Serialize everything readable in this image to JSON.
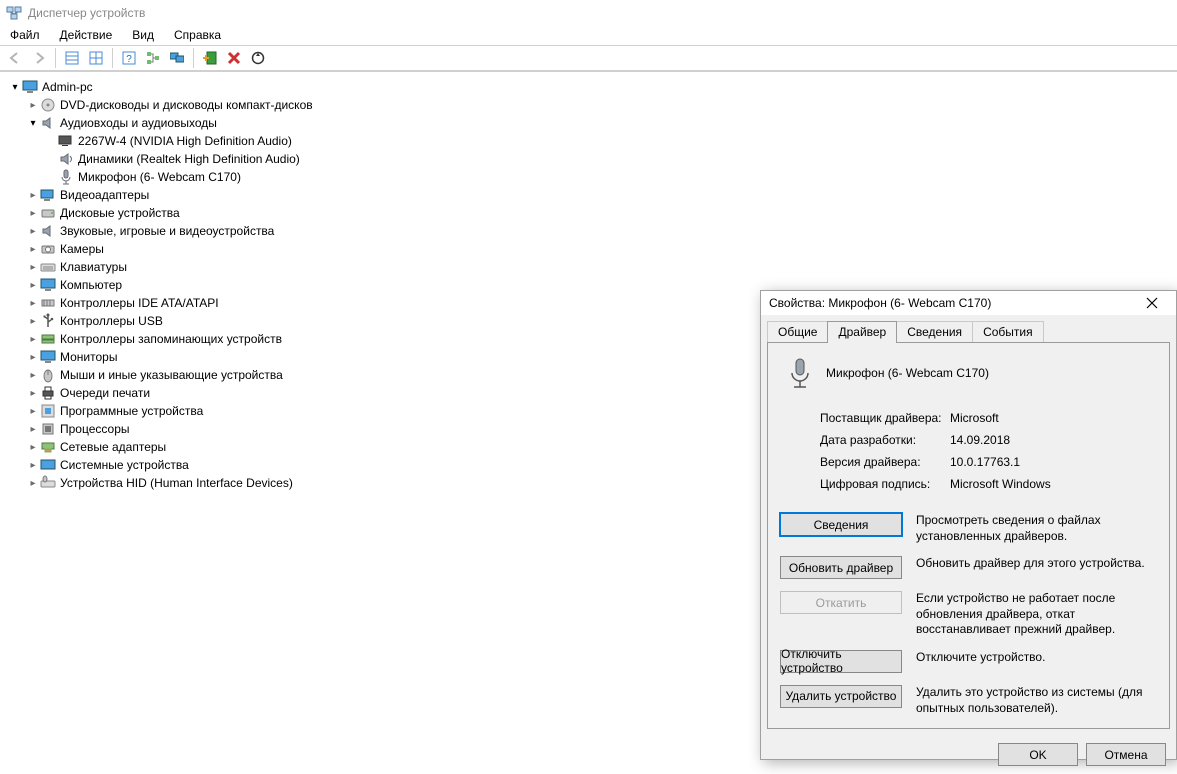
{
  "window": {
    "title": "Диспетчер устройств"
  },
  "menu": {
    "file": "Файл",
    "action": "Действие",
    "view": "Вид",
    "help": "Справка"
  },
  "toolbar_icons": {
    "back": "back-icon",
    "forward": "forward-icon",
    "table": "table-icon",
    "grid": "grid-icon",
    "help": "help-icon",
    "tree": "tree-icon",
    "monitors": "monitors-icon",
    "add_hw": "add-hardware-icon",
    "remove": "remove-icon",
    "refresh": "refresh-icon"
  },
  "tree": {
    "root": "Admin-pc",
    "dvd": "DVD-дисководы и дисководы компакт-дисков",
    "audio": "Аудиовходы и аудиовыходы",
    "audio_children": [
      "2267W-4 (NVIDIA High Definition Audio)",
      "Динамики (Realtek High Definition Audio)",
      "Микрофон (6- Webcam C170)"
    ],
    "video": "Видеоадаптеры",
    "disk": "Дисковые устройства",
    "svc": "Звуковые, игровые и видеоустройства",
    "cameras": "Камеры",
    "kb": "Клавиатуры",
    "pc": "Компьютер",
    "ide": "Контроллеры IDE ATA/ATAPI",
    "usb": "Контроллеры USB",
    "storage": "Контроллеры запоминающих устройств",
    "monitors": "Мониторы",
    "mice": "Мыши и иные указывающие устройства",
    "print": "Очереди печати",
    "soft": "Программные устройства",
    "cpu": "Процессоры",
    "net": "Сетевые адаптеры",
    "system": "Системные устройства",
    "hid": "Устройства HID (Human Interface Devices)"
  },
  "dialog": {
    "title": "Свойства: Микрофон (6- Webcam C170)",
    "tabs": {
      "general": "Общие",
      "driver": "Драйвер",
      "details": "Сведения",
      "events": "События"
    },
    "device_name": "Микрофон (6- Webcam C170)",
    "labels": {
      "vendor": "Поставщик драйвера:",
      "date": "Дата разработки:",
      "version": "Версия драйвера:",
      "signer": "Цифровая подпись:"
    },
    "values": {
      "vendor": "Microsoft",
      "date": "14.09.2018",
      "version": "10.0.17763.1",
      "signer": "Microsoft Windows"
    },
    "buttons": {
      "details": "Сведения",
      "update": "Обновить драйвер",
      "rollback": "Откатить",
      "disable": "Отключить устройство",
      "uninstall": "Удалить устройство",
      "ok": "OK",
      "cancel": "Отмена"
    },
    "descriptions": {
      "details": "Просмотреть сведения о файлах установленных драйверов.",
      "update": "Обновить драйвер для этого устройства.",
      "rollback": "Если устройство не работает после обновления драйвера, откат восстанавливает прежний драйвер.",
      "disable": "Отключите устройство.",
      "uninstall": "Удалить это устройство из системы (для опытных пользователей)."
    }
  }
}
